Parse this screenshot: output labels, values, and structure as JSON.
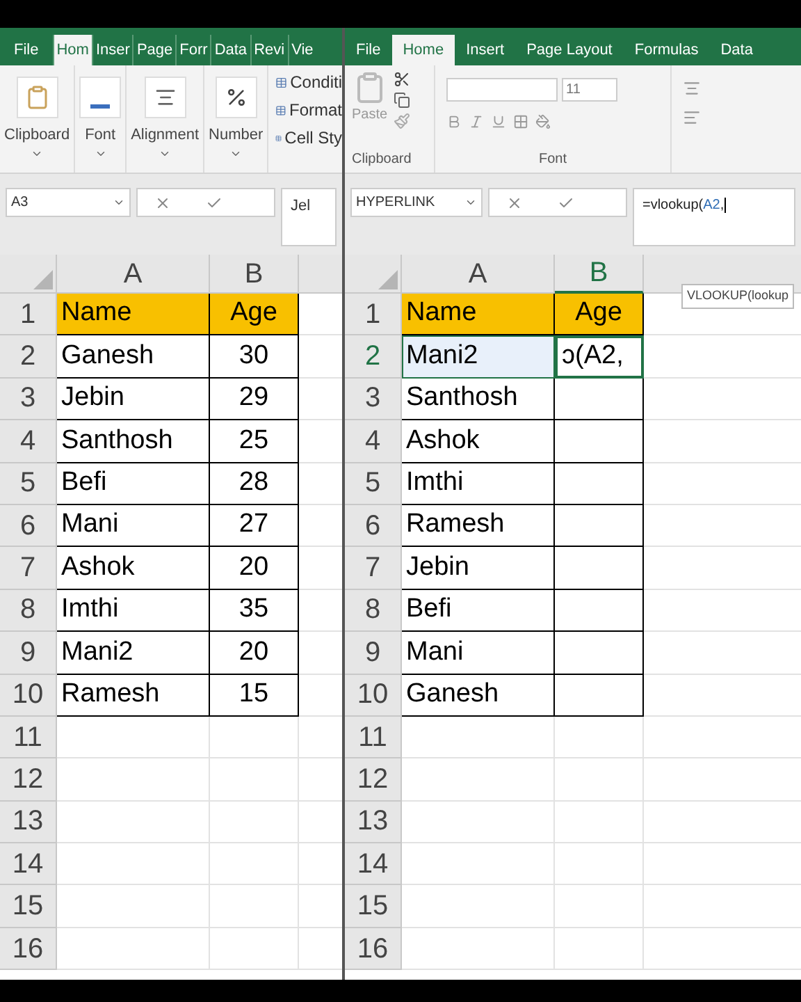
{
  "left": {
    "tabs": [
      {
        "label": "File",
        "selected": false
      },
      {
        "label": "Hom",
        "selected": true
      },
      {
        "label": "Inser",
        "selected": false
      },
      {
        "label": "Page",
        "selected": false
      },
      {
        "label": "Forr",
        "selected": false
      },
      {
        "label": "Data",
        "selected": false
      },
      {
        "label": "Revi",
        "selected": false
      },
      {
        "label": "Vie",
        "selected": false
      }
    ],
    "ribbon_groups": [
      {
        "label": "Clipboard",
        "kind": "clipboard"
      },
      {
        "label": "Font",
        "kind": "font"
      },
      {
        "label": "Alignment",
        "kind": "alignment"
      },
      {
        "label": "Number",
        "kind": "number"
      }
    ],
    "styles": [
      "Conditi",
      "Format",
      "Cell Sty"
    ],
    "name_box": "A3",
    "formula": "Jel",
    "columns": [
      {
        "label": "A",
        "selected": false
      },
      {
        "label": "B",
        "selected": false
      }
    ],
    "rows": [
      {
        "number": "1",
        "kind": "header",
        "selected": false,
        "cells": [
          {
            "text": "Name"
          },
          {
            "text": "Age"
          }
        ]
      },
      {
        "number": "2",
        "kind": "data",
        "selected": false,
        "cells": [
          {
            "text": "Ganesh"
          },
          {
            "text": "30"
          }
        ]
      },
      {
        "number": "3",
        "kind": "data",
        "selected": false,
        "cells": [
          {
            "text": "Jebin"
          },
          {
            "text": "29"
          }
        ]
      },
      {
        "number": "4",
        "kind": "data",
        "selected": false,
        "cells": [
          {
            "text": "Santhosh"
          },
          {
            "text": "25"
          }
        ]
      },
      {
        "number": "5",
        "kind": "data",
        "selected": false,
        "cells": [
          {
            "text": "Befi"
          },
          {
            "text": "28"
          }
        ]
      },
      {
        "number": "6",
        "kind": "data",
        "selected": false,
        "cells": [
          {
            "text": "Mani"
          },
          {
            "text": "27"
          }
        ]
      },
      {
        "number": "7",
        "kind": "data",
        "selected": false,
        "cells": [
          {
            "text": "Ashok"
          },
          {
            "text": "20"
          }
        ]
      },
      {
        "number": "8",
        "kind": "data",
        "selected": false,
        "cells": [
          {
            "text": "Imthi"
          },
          {
            "text": "35"
          }
        ]
      },
      {
        "number": "9",
        "kind": "data",
        "selected": false,
        "cells": [
          {
            "text": "Mani2"
          },
          {
            "text": "20"
          }
        ]
      },
      {
        "number": "10",
        "kind": "data",
        "selected": false,
        "cells": [
          {
            "text": "Ramesh"
          },
          {
            "text": "15"
          }
        ]
      },
      {
        "number": "11",
        "kind": "empty",
        "selected": false,
        "cells": []
      },
      {
        "number": "12",
        "kind": "empty",
        "selected": false,
        "cells": []
      },
      {
        "number": "13",
        "kind": "empty",
        "selected": false,
        "cells": []
      },
      {
        "number": "14",
        "kind": "empty",
        "selected": false,
        "cells": []
      },
      {
        "number": "15",
        "kind": "empty",
        "selected": false,
        "cells": []
      },
      {
        "number": "16",
        "kind": "empty",
        "selected": false,
        "cells": []
      }
    ]
  },
  "right": {
    "tabs": [
      {
        "label": "File",
        "selected": false
      },
      {
        "label": "Home",
        "selected": true
      },
      {
        "label": "Insert",
        "selected": false
      },
      {
        "label": "Page Layout",
        "selected": false
      },
      {
        "label": "Formulas",
        "selected": false
      },
      {
        "label": "Data",
        "selected": false
      }
    ],
    "paste_label": "Paste",
    "font_size": "11",
    "group_labels": [
      "Clipboard",
      "Font"
    ],
    "name_box": "HYPERLINK",
    "formula_parts": [
      {
        "text": "=vlookup(",
        "kind": "plain"
      },
      {
        "text": "A2",
        "kind": "ref"
      },
      {
        "text": ",",
        "kind": "plain"
      }
    ],
    "tooltip": "VLOOKUP(lookup",
    "columns": [
      {
        "label": "A",
        "selected": false
      },
      {
        "label": "B",
        "selected": true
      }
    ],
    "rows": [
      {
        "number": "1",
        "kind": "header",
        "selected": false,
        "cells": [
          {
            "text": "Name"
          },
          {
            "text": "Age"
          }
        ]
      },
      {
        "number": "2",
        "kind": "data",
        "selected": true,
        "cells": [
          {
            "text": "Mani2",
            "selected": true,
            "active": false
          },
          {
            "text": "ɔ(A2,",
            "selected": true,
            "active": true
          }
        ]
      },
      {
        "number": "3",
        "kind": "data",
        "selected": false,
        "cells": [
          {
            "text": "Santhosh"
          }
        ]
      },
      {
        "number": "4",
        "kind": "data",
        "selected": false,
        "cells": [
          {
            "text": "Ashok"
          }
        ]
      },
      {
        "number": "5",
        "kind": "data",
        "selected": false,
        "cells": [
          {
            "text": "Imthi"
          }
        ]
      },
      {
        "number": "6",
        "kind": "data",
        "selected": false,
        "cells": [
          {
            "text": "Ramesh"
          }
        ]
      },
      {
        "number": "7",
        "kind": "data",
        "selected": false,
        "cells": [
          {
            "text": "Jebin"
          }
        ]
      },
      {
        "number": "8",
        "kind": "data",
        "selected": false,
        "cells": [
          {
            "text": "Befi"
          }
        ]
      },
      {
        "number": "9",
        "kind": "data",
        "selected": false,
        "cells": [
          {
            "text": "Mani"
          }
        ]
      },
      {
        "number": "10",
        "kind": "data",
        "selected": false,
        "cells": [
          {
            "text": "Ganesh"
          }
        ]
      },
      {
        "number": "11",
        "kind": "empty",
        "selected": false,
        "cells": []
      },
      {
        "number": "12",
        "kind": "empty",
        "selected": false,
        "cells": []
      },
      {
        "number": "13",
        "kind": "empty",
        "selected": false,
        "cells": []
      },
      {
        "number": "14",
        "kind": "empty",
        "selected": false,
        "cells": []
      },
      {
        "number": "15",
        "kind": "empty",
        "selected": false,
        "cells": []
      },
      {
        "number": "16",
        "kind": "empty",
        "selected": false,
        "cells": []
      }
    ]
  }
}
